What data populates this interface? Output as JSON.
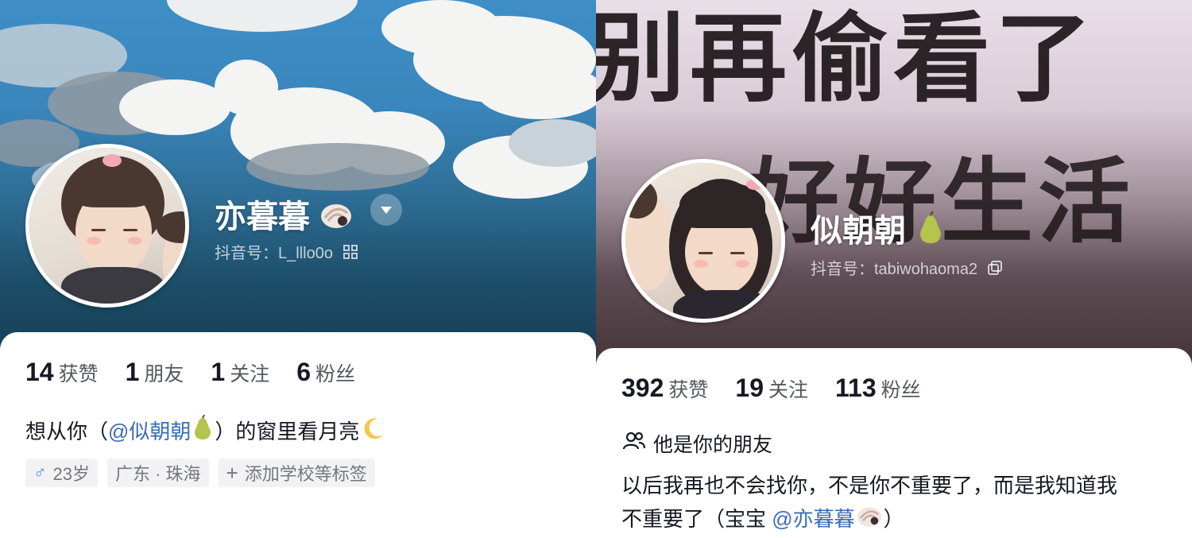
{
  "left_profile": {
    "name": "亦暮暮",
    "id_label": "抖音号：",
    "id_value": "L_lllo0o",
    "stats": [
      {
        "num": "14",
        "label": "获赞"
      },
      {
        "num": "1",
        "label": "朋友"
      },
      {
        "num": "1",
        "label": "关注"
      },
      {
        "num": "6",
        "label": "粉丝"
      }
    ],
    "bio": {
      "prefix": "想从你（",
      "mention": "@似朝朝",
      "suffix": "）的窗里看月亮"
    },
    "tags": {
      "gender_symbol": "♂",
      "age": "23岁",
      "location": "广东 · 珠海",
      "add_school": "添加学校等标签",
      "add_plus": "+"
    }
  },
  "right_profile": {
    "name": "似朝朝",
    "id_label": "抖音号：",
    "id_value": "tabiwohaoma2",
    "banner_text_line1": "别再偷看了",
    "banner_text_line2": "好好生活",
    "stats": [
      {
        "num": "392",
        "label": "获赞"
      },
      {
        "num": "19",
        "label": "关注"
      },
      {
        "num": "113",
        "label": "粉丝"
      }
    ],
    "friend_text": "他是你的朋友",
    "bio_line1": "以后我再也不会找你，不是你不重要了，而是我知道我",
    "bio_line2_prefix": "不重要了（宝宝 ",
    "bio_line2_mention": "@亦暮暮",
    "bio_line2_suffix": "）"
  },
  "colors": {
    "mention": "#3b6db3",
    "stat_number": "#161823",
    "male_icon": "#3f8ff0"
  }
}
